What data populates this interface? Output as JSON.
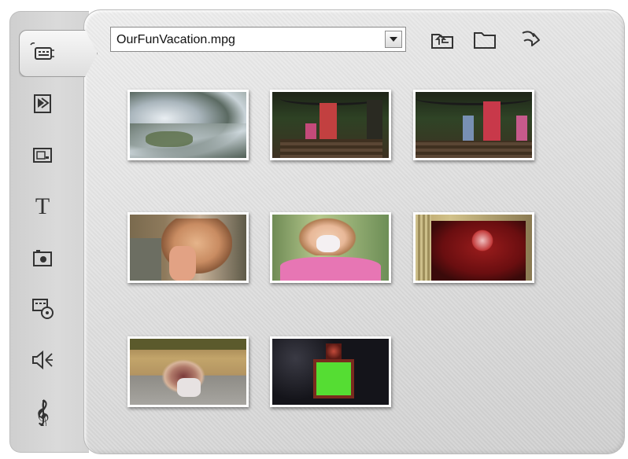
{
  "file_dropdown": {
    "value": "OurFunVacation.mpg"
  },
  "toolbar": {
    "buttons": [
      "folder-up-icon",
      "folder-icon",
      "next-arrow-icon"
    ]
  },
  "tabs": [
    "video-clips-icon",
    "transitions-icon",
    "photos-icon",
    "titles-icon",
    "still-images-icon",
    "disc-menus-icon",
    "sound-effects-icon",
    "music-icon"
  ],
  "thumbnails": [
    {
      "scene": "snowy rocky water"
    },
    {
      "scene": "family in garden archway"
    },
    {
      "scene": "family in garden archway 2"
    },
    {
      "scene": "child eating close-up"
    },
    {
      "scene": "girl with face paint"
    },
    {
      "scene": "red flowered wall"
    },
    {
      "scene": "children sitting in plaza"
    },
    {
      "scene": "green screen frame"
    }
  ]
}
